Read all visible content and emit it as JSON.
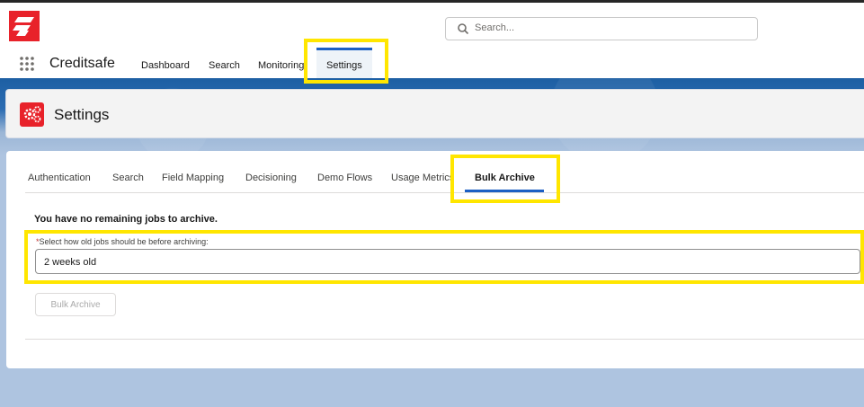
{
  "header": {
    "search_placeholder": "Search...",
    "app_name": "Creditsafe",
    "nav": [
      "Dashboard",
      "Search",
      "Monitoring",
      "Settings"
    ]
  },
  "page": {
    "title": "Settings"
  },
  "tabs": [
    "Authentication",
    "Search",
    "Field Mapping",
    "Decisioning",
    "Demo Flows",
    "Usage Metrics",
    "Bulk Archive"
  ],
  "content": {
    "info": "You have no remaining jobs to archive.",
    "field_label": "Select how old jobs should be before archiving:",
    "required_marker": "*",
    "selected_value": "2 weeks old",
    "button_label": "Bulk Archive"
  },
  "colors": {
    "brand": "#e8222a",
    "highlight": "#ffe600",
    "accent": "#1b5fc4"
  }
}
